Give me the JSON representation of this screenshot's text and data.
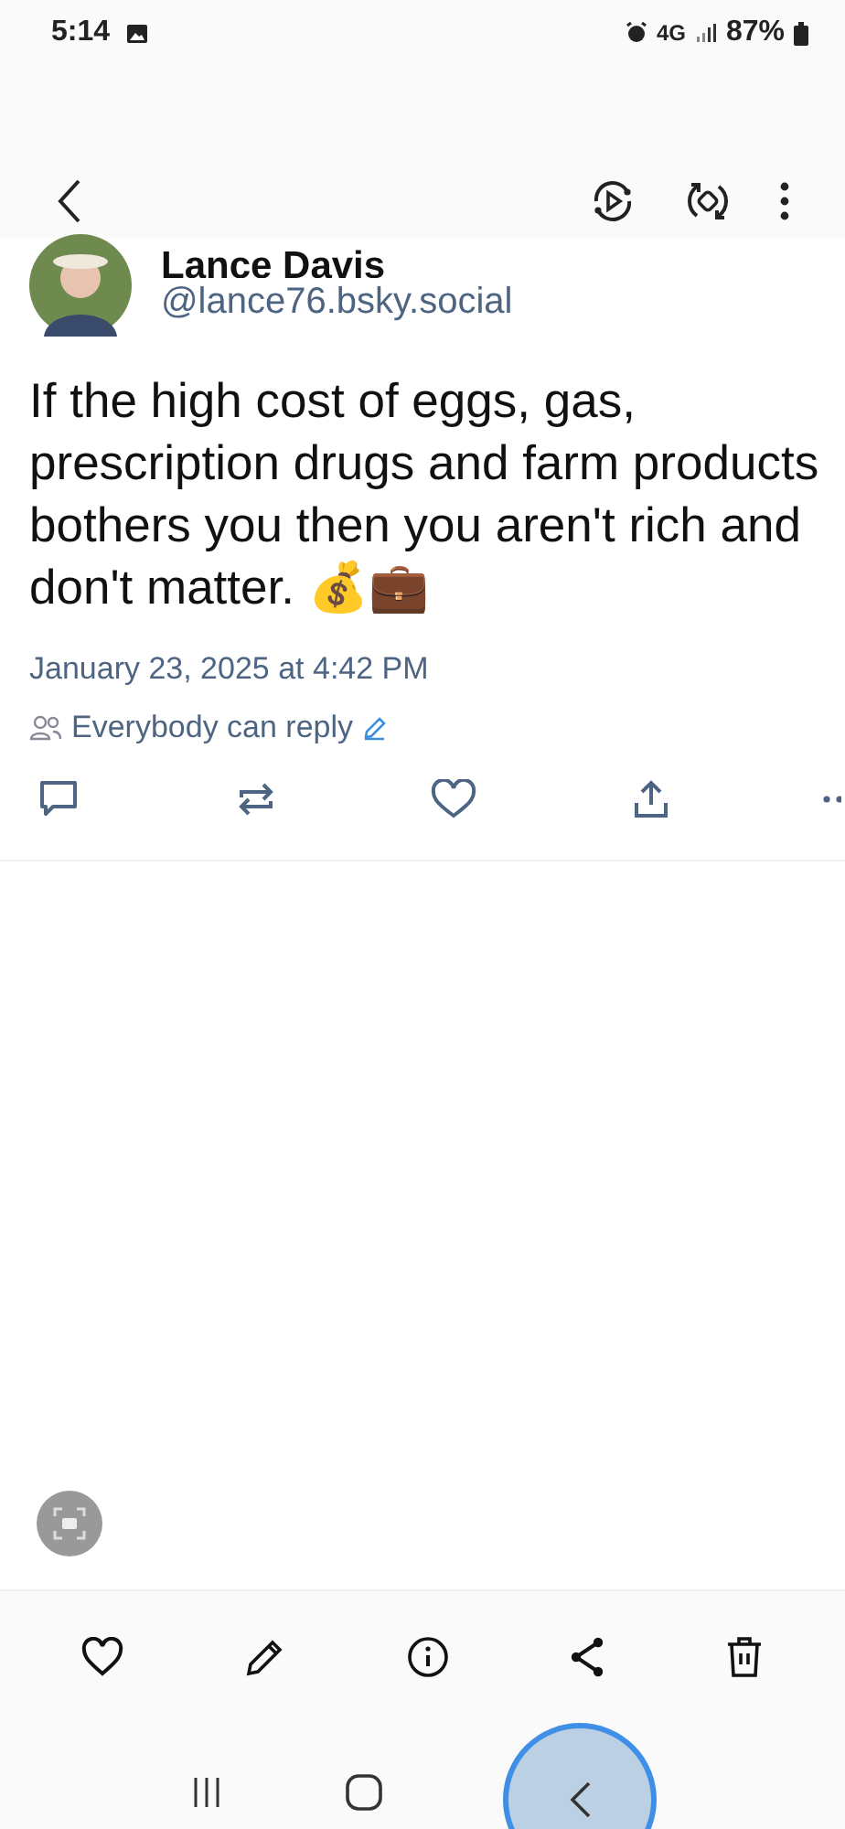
{
  "status_bar": {
    "time": "5:14",
    "network": "4G",
    "battery": "87%"
  },
  "post": {
    "author": "Lance Davis",
    "handle": "@lance76.bsky.social",
    "text": "If the high cost of eggs, gas, prescription drugs and farm products bothers you then you aren't rich and don't matter. 💰💼",
    "timestamp": "January 23, 2025 at 4:42 PM",
    "reply_setting": "Everybody can reply"
  }
}
